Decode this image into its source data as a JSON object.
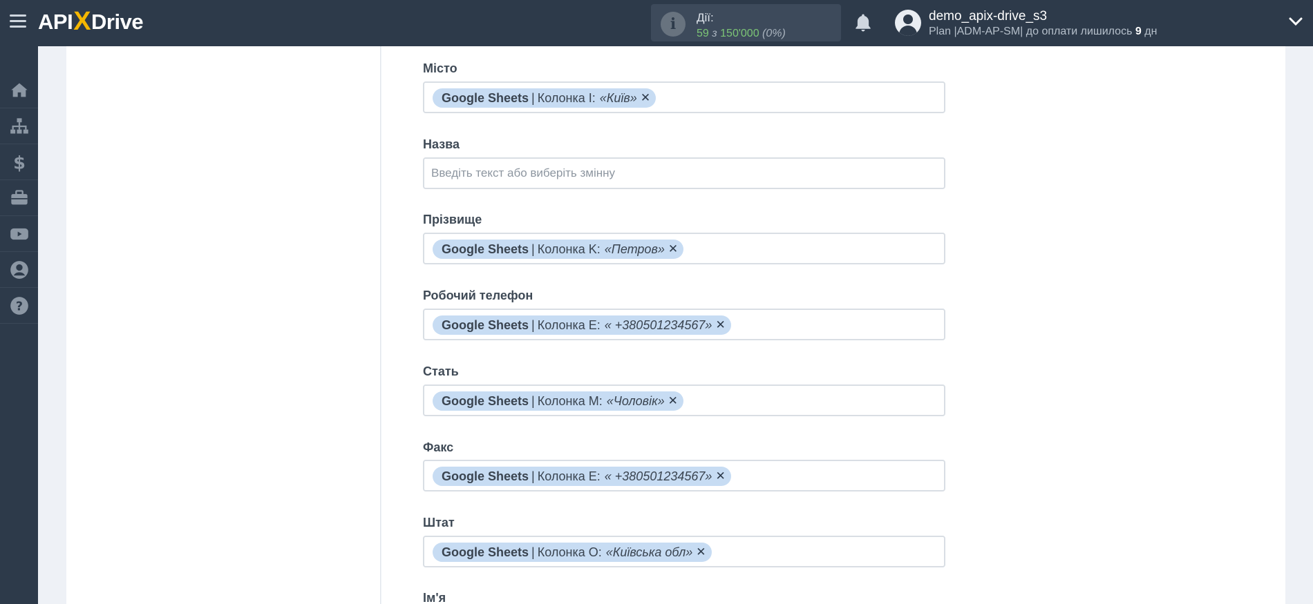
{
  "header": {
    "logo_left": "API",
    "logo_x": "X",
    "logo_right": "Drive",
    "actions_title": "Дії:",
    "actions_used": "59",
    "actions_of": "з",
    "actions_total": "150'000",
    "actions_percent": "(0%)",
    "user_name": "demo_apix-drive_s3",
    "plan_prefix": "Plan |ADM-AP-SM| до оплати лишилось",
    "plan_days": "9",
    "plan_suffix": "дн"
  },
  "sidebar": {
    "items": [
      {
        "icon": "home-icon"
      },
      {
        "icon": "sitemap-icon"
      },
      {
        "icon": "dollar-icon"
      },
      {
        "icon": "briefcase-icon"
      },
      {
        "icon": "youtube-icon"
      },
      {
        "icon": "user-circle-icon"
      },
      {
        "icon": "question-icon"
      }
    ]
  },
  "form": {
    "fields": [
      {
        "label": "Місто",
        "chip": {
          "source": "Google Sheets",
          "column": "Колонка I:",
          "value": "«Київ»"
        }
      },
      {
        "label": "Назва",
        "placeholder": "Введіть текст або виберіть змінну"
      },
      {
        "label": "Прізвище",
        "chip": {
          "source": "Google Sheets",
          "column": "Колонка K:",
          "value": "«Петров»"
        }
      },
      {
        "label": "Робочий телефон",
        "chip": {
          "source": "Google Sheets",
          "column": "Колонка E:",
          "value": "« +380501234567»"
        }
      },
      {
        "label": "Стать",
        "chip": {
          "source": "Google Sheets",
          "column": "Колонка M:",
          "value": "«Чоловік»"
        }
      },
      {
        "label": "Факс",
        "chip": {
          "source": "Google Sheets",
          "column": "Колонка E:",
          "value": "« +380501234567»"
        }
      },
      {
        "label": "Штат",
        "chip": {
          "source": "Google Sheets",
          "column": "Колонка O:",
          "value": "«Київська обл»"
        }
      },
      {
        "label": "Ім'я"
      }
    ]
  },
  "colors": {
    "topbar": "#2d3a4a",
    "chip": "#c7dcf3",
    "accent_green": "#7cc576",
    "logo_x": "#f5b700"
  }
}
